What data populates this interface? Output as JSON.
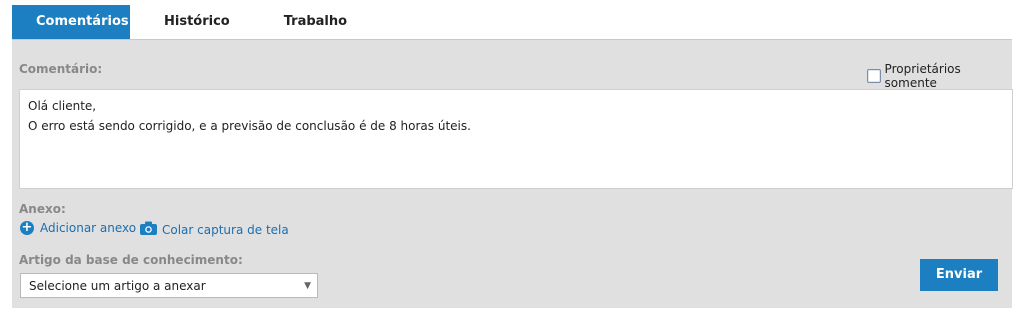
{
  "tabs": [
    {
      "label": "Comentários"
    },
    {
      "label": "Histórico"
    },
    {
      "label": "Trabalho"
    }
  ],
  "comment": {
    "label": "Comentário:",
    "owners_only_label": "Proprietários somente",
    "text_lines": [
      "Olá cliente,",
      "O erro está sendo corrigido, e a previsão de conclusão é de 8 horas úteis."
    ]
  },
  "attachment": {
    "label": "Anexo:",
    "add_label": "Adicionar anexo",
    "paste_screenshot_label": "Colar captura de tela"
  },
  "kb": {
    "label": "Artigo da base de conhecimento:",
    "select_value": "Selecione um artigo a anexar"
  },
  "actions": {
    "send_label": "Enviar"
  },
  "colors": {
    "accent": "#1b7fc1",
    "panel_bg": "#e0e0e0",
    "link": "#1a6fb0"
  },
  "icons": {
    "add": "plus-circle-icon",
    "screenshot": "camera-icon",
    "dropdown": "chevron-down-icon"
  }
}
